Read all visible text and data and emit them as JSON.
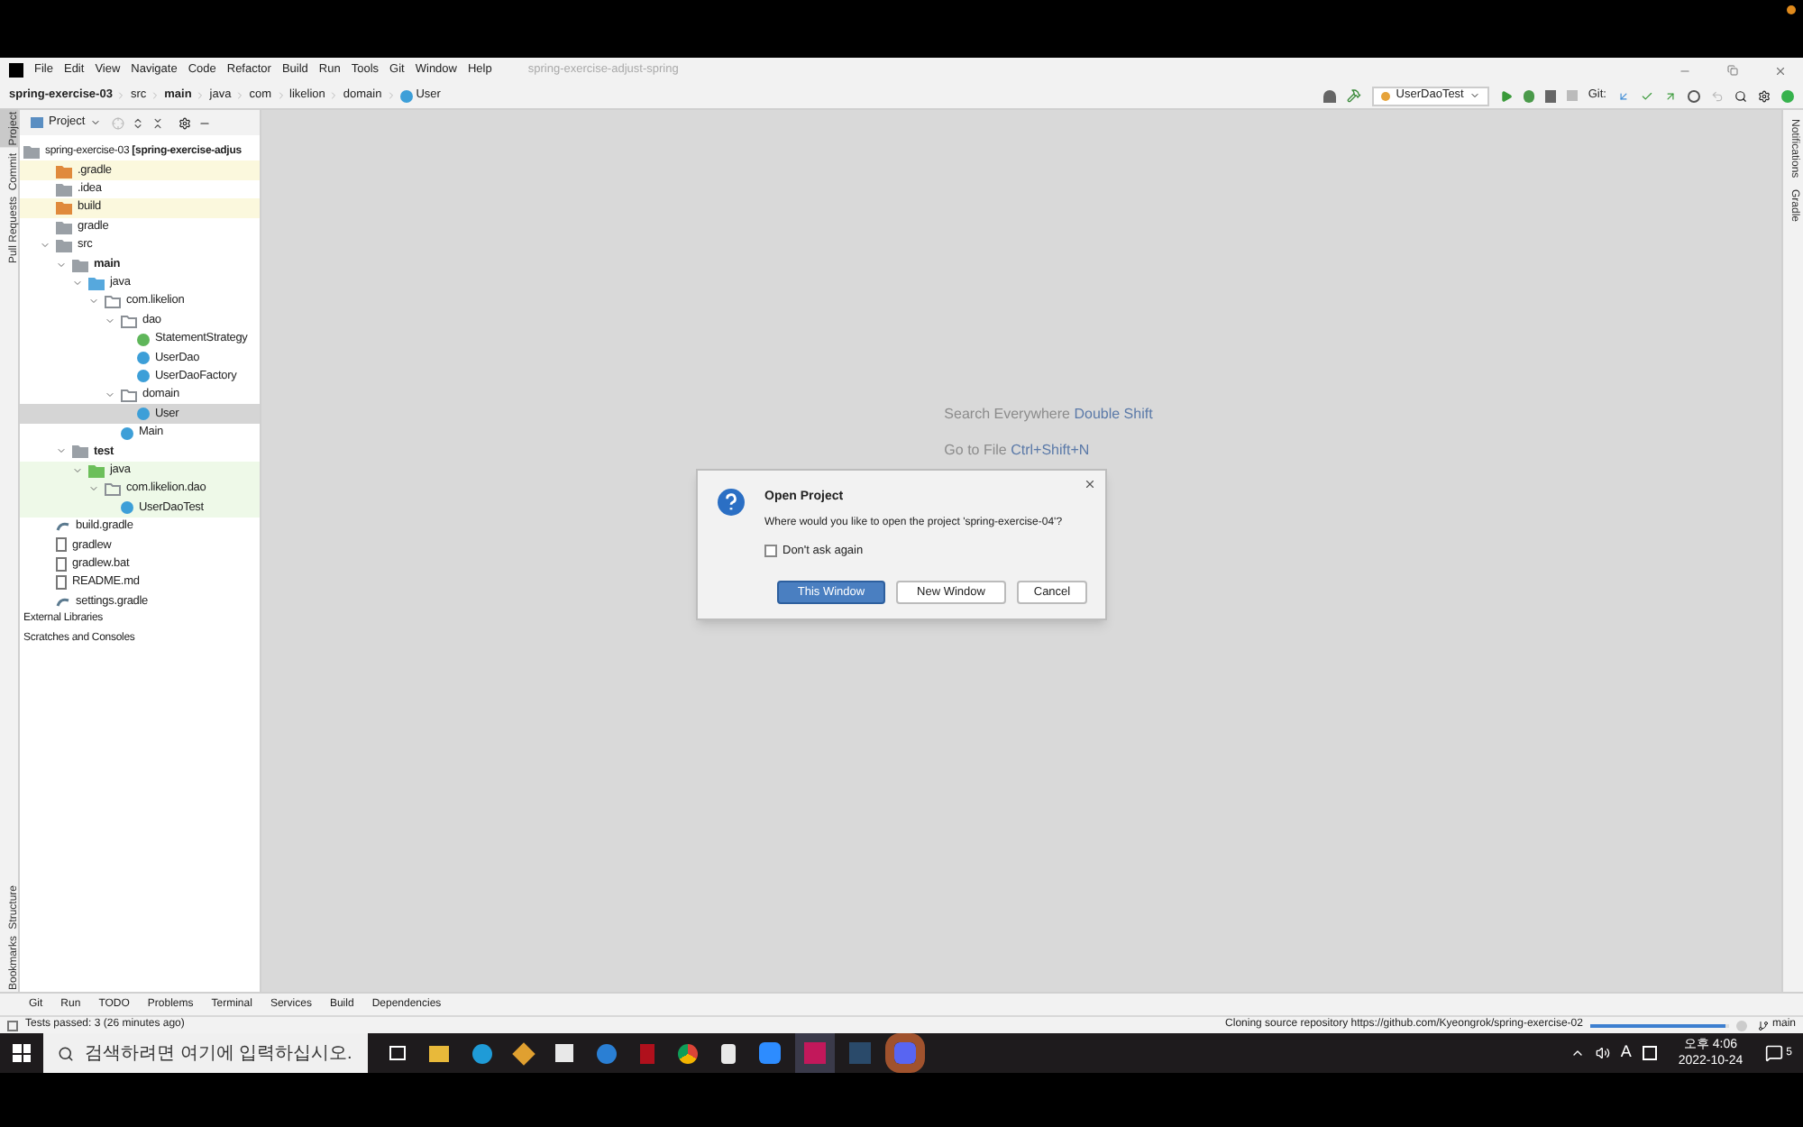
{
  "menu_bar": {
    "items": [
      "File",
      "Edit",
      "View",
      "Navigate",
      "Code",
      "Refactor",
      "Build",
      "Run",
      "Tools",
      "Git",
      "Window",
      "Help"
    ],
    "project_title": "spring-exercise-adjust-spring"
  },
  "breadcrumbs": [
    {
      "label": "spring-exercise-03",
      "bold": true,
      "kind": "text"
    },
    {
      "label": "src",
      "bold": false,
      "kind": "text"
    },
    {
      "label": "main",
      "bold": true,
      "kind": "text"
    },
    {
      "label": "java",
      "bold": false,
      "kind": "text"
    },
    {
      "label": "com",
      "bold": false,
      "kind": "text"
    },
    {
      "label": "likelion",
      "bold": false,
      "kind": "text"
    },
    {
      "label": "domain",
      "bold": false,
      "kind": "text"
    },
    {
      "label": "User",
      "bold": false,
      "kind": "class"
    }
  ],
  "toolbar": {
    "run_config": "UserDaoTest",
    "git_label": "Git:"
  },
  "left_strip": [
    {
      "label": "Project",
      "selected": true
    },
    {
      "label": "Commit",
      "selected": false
    },
    {
      "label": "Pull Requests",
      "selected": false
    }
  ],
  "left_strip_bottom": [
    {
      "label": "Structure",
      "selected": false
    },
    {
      "label": "Bookmarks",
      "selected": false
    }
  ],
  "right_strip": [
    {
      "label": "Notifications",
      "selected": false
    },
    {
      "label": "Gradle",
      "selected": false
    }
  ],
  "project_panel": {
    "title": "Project",
    "tree": [
      {
        "label": "spring-exercise-03 **[spring-exercise-adjus**",
        "kind": "root",
        "bold": false,
        "selected": false,
        "expanded": true,
        "children": [
          {
            "label": ".gradle",
            "kind": "folder-excluded",
            "bold": false,
            "selected": false
          },
          {
            "label": ".idea",
            "kind": "folder",
            "bold": false,
            "selected": false
          },
          {
            "label": "build",
            "kind": "folder-excluded",
            "bold": false,
            "selected": false
          },
          {
            "label": "gradle",
            "kind": "folder",
            "bold": false,
            "selected": false
          },
          {
            "label": "src",
            "kind": "folder",
            "bold": false,
            "selected": false,
            "expanded": true,
            "children": [
              {
                "label": "main",
                "kind": "module",
                "bold": true,
                "selected": false,
                "expanded": true,
                "children": [
                  {
                    "label": "java",
                    "kind": "source",
                    "bold": false,
                    "selected": false,
                    "expanded": true,
                    "children": [
                      {
                        "label": "com.likelion",
                        "kind": "package",
                        "bold": false,
                        "selected": false,
                        "expanded": true,
                        "children": [
                          {
                            "label": "dao",
                            "kind": "package",
                            "bold": false,
                            "selected": false,
                            "expanded": true,
                            "children": [
                              {
                                "label": "StatementStrategy",
                                "kind": "interface",
                                "bold": false,
                                "selected": false
                              },
                              {
                                "label": "UserDao",
                                "kind": "class",
                                "bold": false,
                                "selected": false
                              },
                              {
                                "label": "UserDaoFactory",
                                "kind": "class",
                                "bold": false,
                                "selected": false
                              }
                            ]
                          },
                          {
                            "label": "domain",
                            "kind": "package",
                            "bold": false,
                            "selected": false,
                            "expanded": true,
                            "children": [
                              {
                                "label": "User",
                                "kind": "class",
                                "bold": false,
                                "selected": true
                              }
                            ]
                          },
                          {
                            "label": "Main",
                            "kind": "class",
                            "bold": false,
                            "selected": false
                          }
                        ]
                      }
                    ]
                  }
                ]
              },
              {
                "label": "test",
                "kind": "module",
                "bold": true,
                "selected": false,
                "expanded": true,
                "children": [
                  {
                    "label": "java",
                    "kind": "test-source",
                    "bold": false,
                    "selected": false,
                    "expanded": true,
                    "children": [
                      {
                        "label": "com.likelion.dao",
                        "kind": "test-package",
                        "bold": false,
                        "selected": false,
                        "expanded": true,
                        "children": [
                          {
                            "label": "UserDaoTest",
                            "kind": "test-class",
                            "bold": false,
                            "selected": false
                          }
                        ]
                      }
                    ]
                  }
                ]
              }
            ]
          },
          {
            "label": "build.gradle",
            "kind": "gradle-file",
            "bold": false,
            "selected": false
          },
          {
            "label": "gradlew",
            "kind": "file",
            "bold": false,
            "selected": false
          },
          {
            "label": "gradlew.bat",
            "kind": "file",
            "bold": false,
            "selected": false
          },
          {
            "label": "README.md",
            "kind": "file",
            "bold": false,
            "selected": false
          },
          {
            "label": "settings.gradle",
            "kind": "gradle-file",
            "bold": false,
            "selected": false
          }
        ]
      },
      {
        "label": "External Libraries",
        "kind": "plain",
        "bold": false,
        "selected": false
      },
      {
        "label": "Scratches and Consoles",
        "kind": "plain",
        "bold": false,
        "selected": false
      }
    ]
  },
  "editor_hints": [
    {
      "text": "Search Everywhere",
      "shortcut": "Double Shift"
    },
    {
      "text": "Go to File",
      "shortcut": "Ctrl+Shift+N"
    }
  ],
  "dialog": {
    "title": "Open Project",
    "message": "Where would you like to open the project 'spring-exercise-04'?",
    "checkbox": {
      "label": "Don't ask again",
      "checked": false
    },
    "buttons": [
      {
        "label": "This Window",
        "selected": true
      },
      {
        "label": "New Window",
        "selected": false
      },
      {
        "label": "Cancel",
        "selected": false
      }
    ]
  },
  "tool_windows": [
    "Git",
    "Run",
    "TODO",
    "Problems",
    "Terminal",
    "Services",
    "Build",
    "Dependencies"
  ],
  "status_bar": {
    "message": "Tests passed: 3 (26 minutes ago)",
    "progress_text": "Cloning source repository https://github.com/Kyeongrok/spring-exercise-02",
    "level": 0.97,
    "branch": "main"
  },
  "taskbar": {
    "search_placeholder": "검색하려면 여기에 입력하십시오.",
    "ime": "A",
    "time": "오후 4:06",
    "date": "2022-10-24",
    "notifications": "5"
  }
}
